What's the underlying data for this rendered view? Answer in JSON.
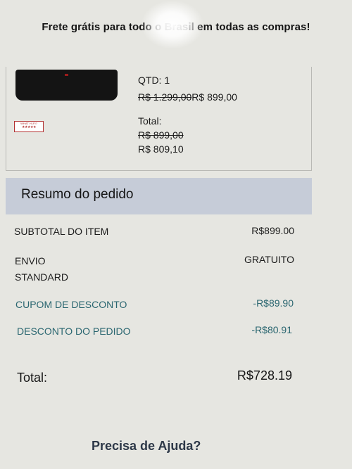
{
  "promo": {
    "text": "Frete grátis para todo o Brasil em todas as compras!"
  },
  "product": {
    "image_icon": "soundbar-product-image",
    "award_badge": {
      "top": "WHAT HI-FI?",
      "stars": "★★★★★"
    },
    "qty": "QTD: 1",
    "original_price": "R$ 1.299,00",
    "price": "R$ 899,00",
    "total_label": "Total:",
    "total_original": "R$ 899,00",
    "total_final": "R$ 809,10"
  },
  "summary": {
    "title": "Resumo do pedido",
    "subtotal_label": "SUBTOTAL DO ITEM",
    "subtotal_value": "R$899.00",
    "shipping_label": "ENVIO",
    "shipping_method": "STANDARD",
    "shipping_value": "GRATUITO",
    "coupon_label": "CUPOM DE DESCONTO",
    "coupon_value": "-R$89.90",
    "order_discount_label": "DESCONTO DO PEDIDO",
    "order_discount_value": "-R$80.91",
    "total_label": "Total:",
    "total_value": "R$728.19"
  },
  "help": {
    "text": "Precisa de Ajuda?"
  },
  "colors": {
    "summary_header": "#c6ccd8",
    "discount_text": "#2a6670",
    "background": "#e6e6e1"
  }
}
